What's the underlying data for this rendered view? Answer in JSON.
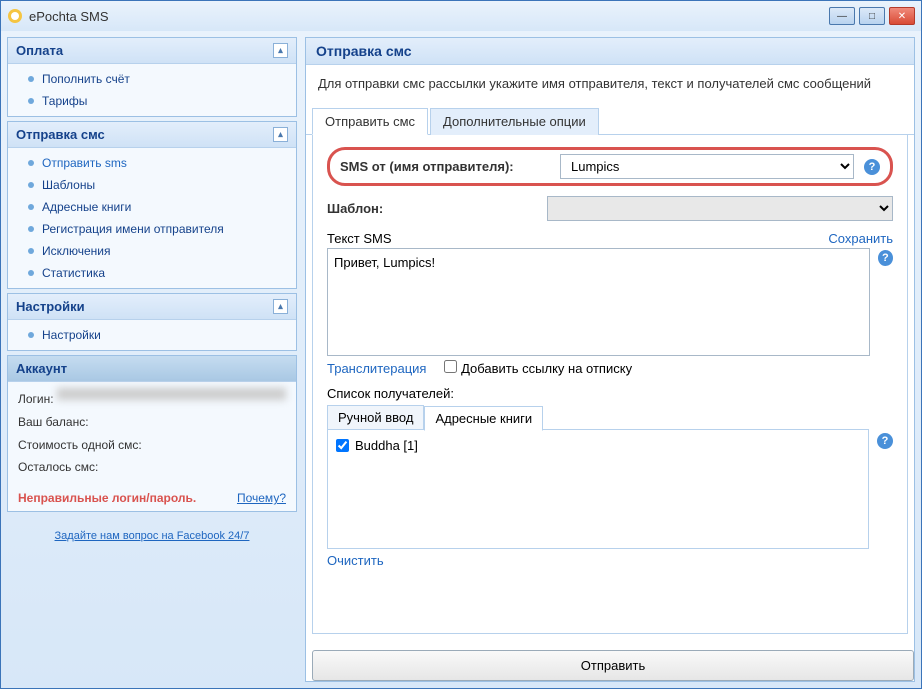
{
  "window": {
    "title": "ePochta SMS"
  },
  "sidebar": {
    "groups": [
      {
        "title": "Оплата",
        "items": [
          "Пополнить счёт",
          "Тарифы"
        ]
      },
      {
        "title": "Отправка смс",
        "items": [
          "Отправить sms",
          "Шаблоны",
          "Адресные книги",
          "Регистрация имени отправителя",
          "Исключения",
          "Статистика"
        ]
      },
      {
        "title": "Настройки",
        "items": [
          "Настройки"
        ]
      }
    ],
    "account": {
      "title": "Аккаунт",
      "login_label": "Логин:",
      "balance_label": "Ваш баланс:",
      "sms_cost_label": "Стоимость одной смс:",
      "sms_left_label": "Осталось смс:"
    },
    "error": {
      "text": "Неправильные логин/пароль.",
      "why": "Почему?"
    },
    "fb": "Задайте нам вопрос на Facebook 24/7"
  },
  "main": {
    "title": "Отправка смс",
    "desc": "Для отправки смс рассылки укажите имя отправителя, текст и получателей смс сообщений",
    "tabs": {
      "send": "Отправить смс",
      "extra": "Дополнительные опции"
    },
    "sender_label": "SMS от (имя отправителя):",
    "sender_value": "Lumpics",
    "template_label": "Шаблон:",
    "text_label": "Текст SMS",
    "save": "Сохранить",
    "sms_text": "Привет, Lumpics!",
    "translit": "Транслитерация",
    "unsub": "Добавить ссылку на отписку",
    "recipients_label": "Список получателей:",
    "inner_tabs": {
      "manual": "Ручной ввод",
      "books": "Адресные книги"
    },
    "recipient": "Buddha [1]",
    "clear": "Очистить",
    "send_btn": "Отправить"
  }
}
